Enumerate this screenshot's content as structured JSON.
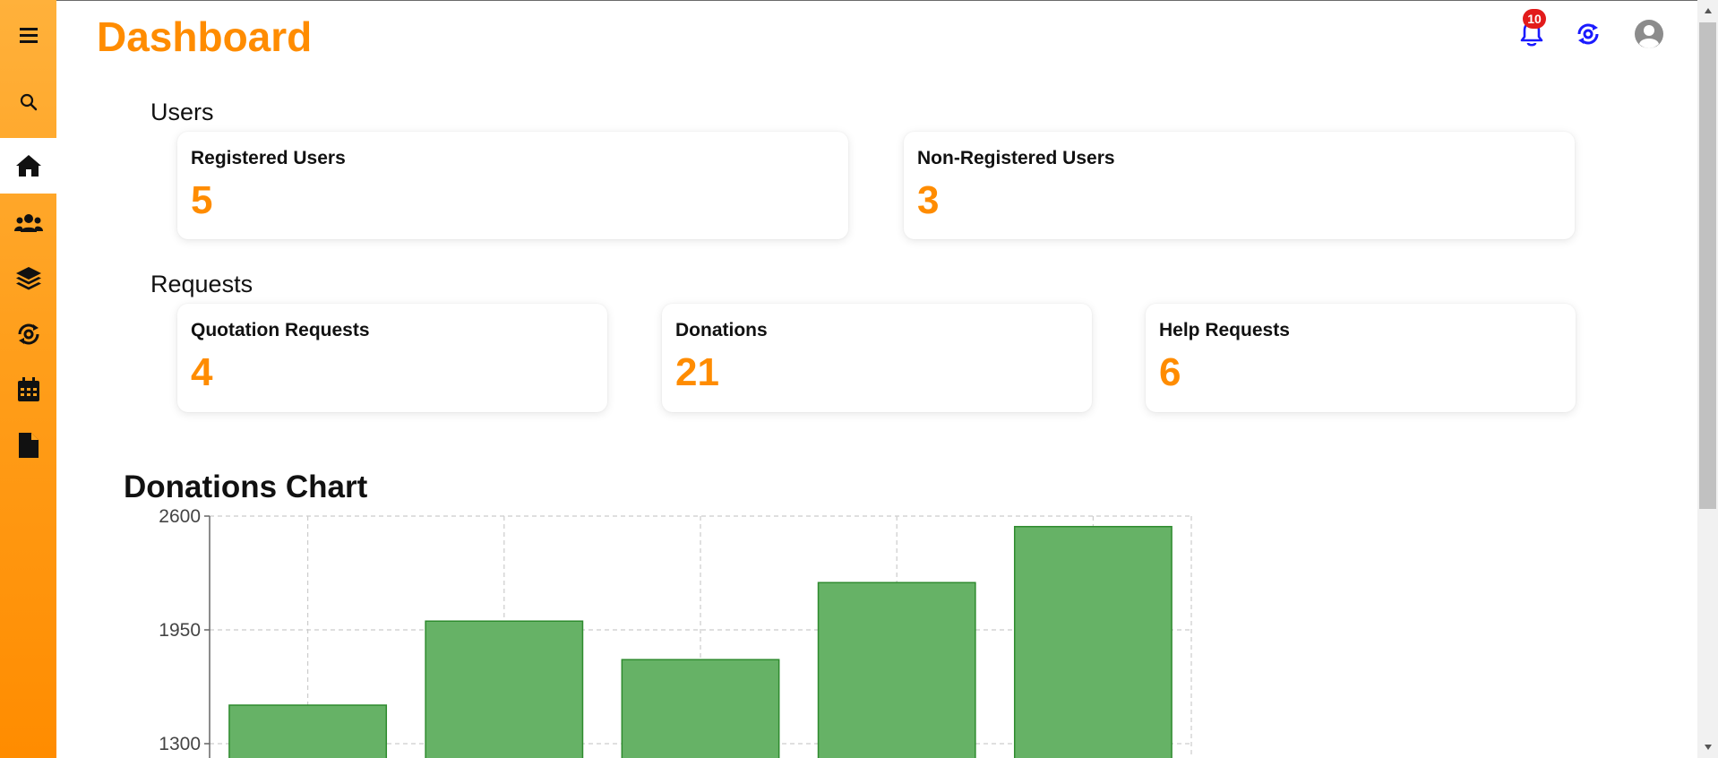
{
  "header": {
    "title": "Dashboard",
    "notification_count": "10",
    "icons": [
      "notification-bell-icon",
      "sync-icon",
      "user-account-icon"
    ]
  },
  "sidebar": {
    "items": [
      {
        "icon": "menu-icon"
      },
      {
        "icon": "search-icon"
      },
      {
        "icon": "home-icon",
        "active": true
      },
      {
        "icon": "users-icon"
      },
      {
        "icon": "layers-icon"
      },
      {
        "icon": "sync-icon"
      },
      {
        "icon": "calendar-icon"
      },
      {
        "icon": "document-icon"
      }
    ]
  },
  "sections": {
    "users": {
      "label": "Users",
      "cards": [
        {
          "title": "Registered Users",
          "value": "5"
        },
        {
          "title": "Non-Registered Users",
          "value": "3"
        }
      ]
    },
    "requests": {
      "label": "Requests",
      "cards": [
        {
          "title": "Quotation Requests",
          "value": "4"
        },
        {
          "title": "Donations",
          "value": "21"
        },
        {
          "title": "Help Requests",
          "value": "6"
        }
      ]
    }
  },
  "chart_title": "Donations Chart",
  "colors": {
    "accent": "#ff8c00",
    "bar_fill": "#66b266",
    "bar_stroke": "#2e8b2e",
    "badge": "#e21b1b",
    "icon_blue": "#1a1aff"
  },
  "chart_data": {
    "type": "bar",
    "title": "Donations Chart",
    "xlabel": "",
    "ylabel": "",
    "categories": [
      "",
      "",
      "",
      "",
      ""
    ],
    "values": [
      1520,
      2000,
      1780,
      2220,
      2540
    ],
    "yticks": [
      1300,
      1950,
      2600
    ],
    "ylim": [
      1300,
      2600
    ],
    "grid": true
  }
}
